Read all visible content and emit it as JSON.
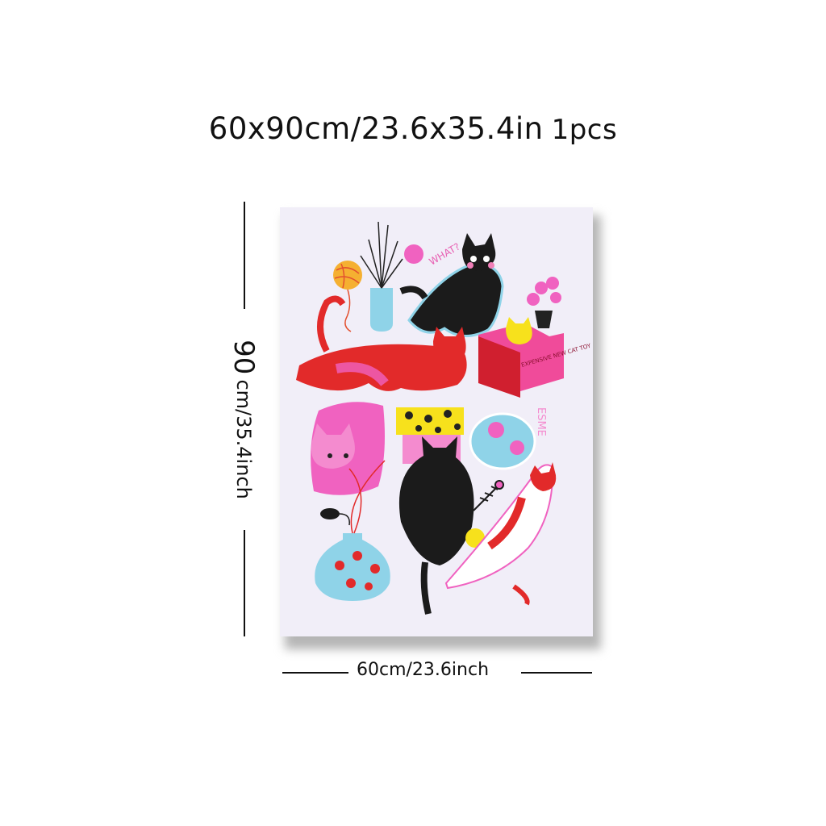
{
  "header": {
    "size_text": "60x90cm/23.6x35.4in",
    "qty_text": "1pcs"
  },
  "dimensions": {
    "height_number": "90",
    "height_text": "cm/35.4inch",
    "width_text": "60cm/23.6inch"
  },
  "artwork": {
    "speech_what": "WHAT?",
    "box_text": "EXPENSIVE NEW CAT TOY",
    "name_text": "ESME"
  }
}
